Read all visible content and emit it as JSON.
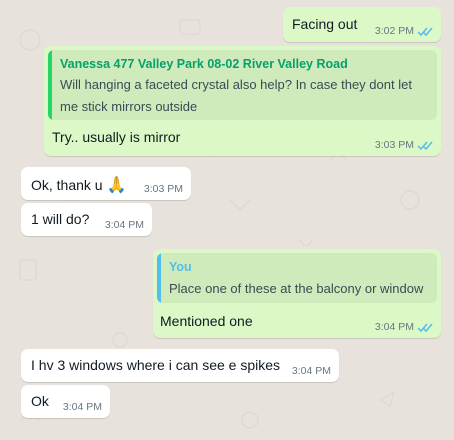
{
  "colors": {
    "outgoing_bubble": "#dcf8c6",
    "incoming_bubble": "#ffffff",
    "wallpaper": "#e7e2db",
    "read_ticks": "#53bdeb",
    "quote_bar_contact": "#25d366",
    "quote_name_contact": "#06a06a",
    "quote_bar_you": "#53bdeb",
    "quote_name_you": "#53bdeb"
  },
  "messages": [
    {
      "direction": "out",
      "text": "Facing out",
      "time": "3:02 PM",
      "status_icon": "double-check-read-icon"
    },
    {
      "direction": "out",
      "quote": {
        "author": "Vanessa 477 Valley Park 08-02 River Valley Road",
        "line1": "Will hanging a faceted crystal also help? In case they dont let",
        "line2": "me stick mirrors outside"
      },
      "text": "Try.. usually is mirror",
      "time": "3:03 PM",
      "status_icon": "double-check-read-icon"
    },
    {
      "direction": "in",
      "text": "Ok, thank u",
      "emoji": "🙏",
      "time": "3:03 PM"
    },
    {
      "direction": "in",
      "text": "1 will do?",
      "time": "3:04 PM"
    },
    {
      "direction": "out",
      "quote": {
        "author": "You",
        "line1": "Place one of these at the balcony or window"
      },
      "text": "Mentioned one",
      "time": "3:04 PM",
      "status_icon": "double-check-read-icon"
    },
    {
      "direction": "in",
      "text": "I hv 3 windows where i can see e spikes",
      "time": "3:04 PM"
    },
    {
      "direction": "in",
      "text": "Ok",
      "time": "3:04 PM"
    }
  ]
}
